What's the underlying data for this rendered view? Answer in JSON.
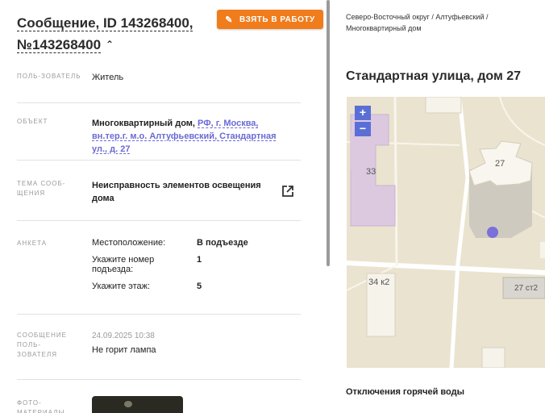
{
  "header": {
    "title": "Сообщение, ID 143268400, №143268400",
    "take_button": "ВЗЯТЬ В РАБОТУ"
  },
  "fields": {
    "user": {
      "label": "ПОЛЬ-ЗОВАТЕЛЬ",
      "value": "Житель"
    },
    "object": {
      "label": "ОБЪЕКТ",
      "value_prefix": "Многоквартирный дом,",
      "value_link": "РФ, г. Москва, вн.тер.г. м.о. Алтуфьевский, Стандартная ул., д. 27"
    },
    "topic": {
      "label": "ТЕМА СООБ-ЩЕНИЯ",
      "value": "Неисправность элементов освещения дома"
    },
    "survey": {
      "label": "АНКЕТА",
      "rows": [
        {
          "key": "Местоположение:",
          "value": "В подъезде"
        },
        {
          "key": "Укажите номер подъезда:",
          "value": "1"
        },
        {
          "key": "Укажите этаж:",
          "value": "5"
        }
      ]
    },
    "message": {
      "label": "СООБЩЕНИЕ ПОЛЬ-ЗОВАТЕЛЯ",
      "date": "24.09.2025 10:38",
      "text": "Не горит лампа"
    },
    "photos": {
      "label": "ФОТО-МАТЕРИАЛЫ"
    }
  },
  "sidebar": {
    "address": "Северо-Восточный округ / Алтуфьевский / Многоквартирный дом",
    "street": "Стандартная улица, дом 27",
    "map": {
      "zoom_in": "+",
      "zoom_out": "−",
      "labels": {
        "b33": "33",
        "b27": "27",
        "b34k2": "34 к2",
        "b27s2": "27 ст2"
      }
    },
    "hot_water": "Отключения горячей воды"
  },
  "colors": {
    "accent": "#f07c1c",
    "link": "#6a6ad6",
    "map_control": "#5a6fd6",
    "marker": "#7b6fd9"
  },
  "icons": {
    "pencil": "pencil-icon",
    "external": "external-link-icon",
    "chevron": "chevron-up-icon"
  }
}
